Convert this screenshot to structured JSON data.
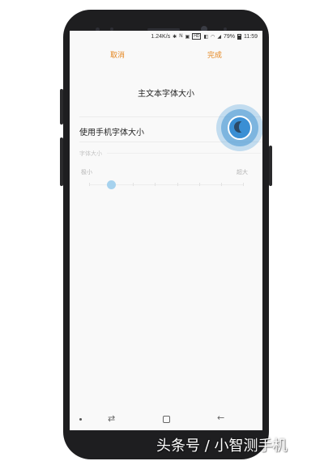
{
  "status_bar": {
    "speed": "1.24K/s",
    "hd_badge": "HD",
    "battery_percent": "79%",
    "time": "11:59"
  },
  "action_bar": {
    "cancel_label": "取消",
    "done_label": "完成"
  },
  "screen": {
    "title": "主文本字体大小",
    "use_phone_font_label": "使用手机字体大小",
    "use_phone_font_enabled": true,
    "section_label": "字体大小",
    "slider": {
      "min_label": "极小",
      "max_label": "超大",
      "steps": 8,
      "value_step": 2
    }
  },
  "nav_bar": {
    "recent_icon": "recent-apps-icon",
    "home_icon": "home-icon",
    "back_icon": "back-arrow-icon"
  },
  "watermark": "头条号 / 小智测手机",
  "colors": {
    "accent": "#e5861f",
    "toggle": "#3a8fd4",
    "slider_thumb": "#a6d2ee"
  }
}
